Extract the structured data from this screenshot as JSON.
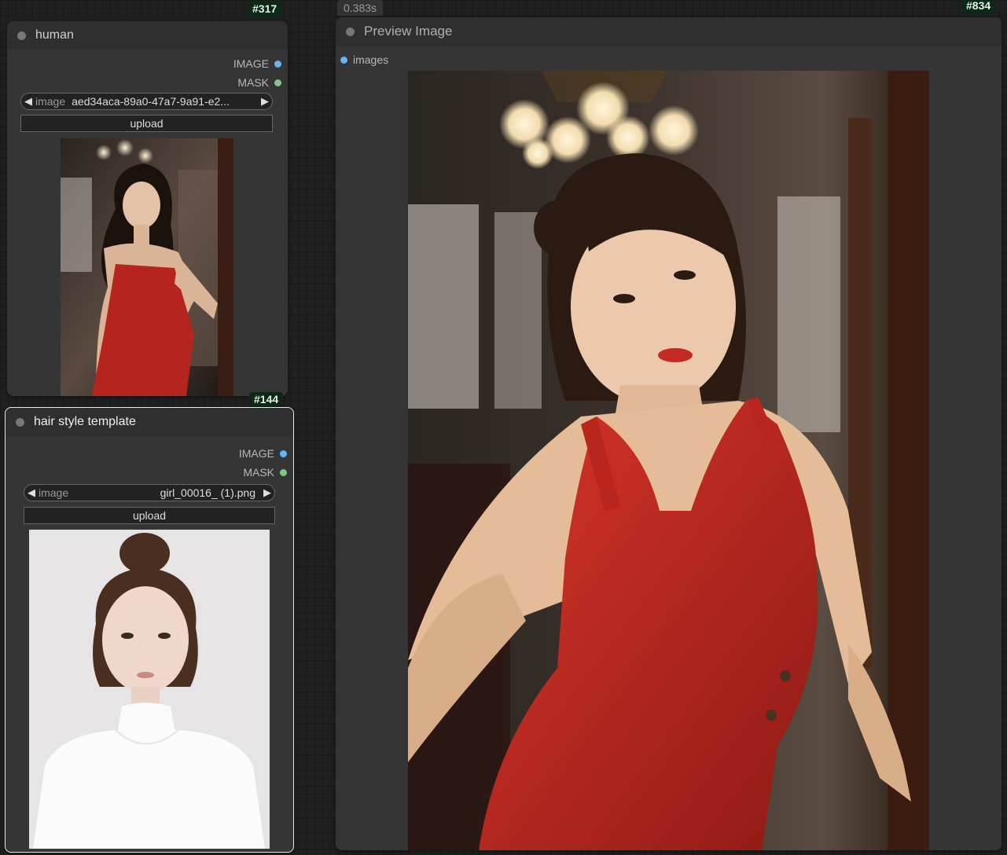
{
  "node_human": {
    "id": "#317",
    "title": "human",
    "outputs": [
      "IMAGE",
      "MASK"
    ],
    "widget_label": "image",
    "widget_value": "aed34aca-89a0-47a7-9a91-e2...",
    "upload_label": "upload"
  },
  "node_hair": {
    "id": "#144",
    "title": "hair style template",
    "outputs": [
      "IMAGE",
      "MASK"
    ],
    "widget_label": "image",
    "widget_value": "girl_00016_ (1).png",
    "upload_label": "upload"
  },
  "node_preview": {
    "id": "#834",
    "exec_time": "0.383s",
    "title": "Preview Image",
    "input": "images"
  },
  "colors": {
    "image_slot": "#64b5f6",
    "mask_slot": "#81c784",
    "node_bg": "#353535",
    "id_badge": "#0a2a16"
  }
}
